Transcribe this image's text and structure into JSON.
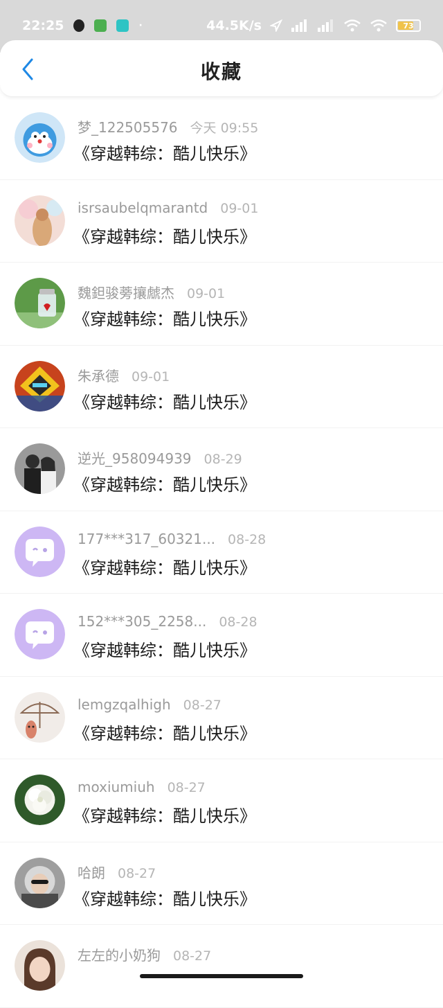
{
  "status_bar": {
    "time": "22:25",
    "speed": "44.5K/s",
    "battery": "73",
    "icons": [
      "qq-icon",
      "app-icon",
      "location-icon",
      "signal-icon",
      "wifi-icon"
    ]
  },
  "header": {
    "title": "收藏"
  },
  "items": [
    {
      "name": "梦_122505576",
      "time": "今天 09:55",
      "work": "《穿越韩综：酷儿快乐》",
      "avatar_color": "#5aa9e6"
    },
    {
      "name": "isrsaubelqmarantd",
      "time": "09-01",
      "work": "《穿越韩综：酷儿快乐》",
      "avatar_color": "#e8b8a8"
    },
    {
      "name": "魏鉭骏蒡攘虤杰",
      "time": "09-01",
      "work": "《穿越韩综：酷儿快乐》",
      "avatar_color": "#4e8a3c"
    },
    {
      "name": "朱承德",
      "time": "09-01",
      "work": "《穿越韩综：酷儿快乐》",
      "avatar_color": "#c7431d"
    },
    {
      "name": "逆光_958094939",
      "time": "08-29",
      "work": "《穿越韩综：酷儿快乐》",
      "avatar_color": "#3a3a3a"
    },
    {
      "name": "177***317_60321...",
      "time": "08-28",
      "work": "《穿越韩综：酷儿快乐》",
      "avatar_color": "#cbb6f2"
    },
    {
      "name": "152***305_2258...",
      "time": "08-28",
      "work": "《穿越韩综：酷儿快乐》",
      "avatar_color": "#cbb6f2"
    },
    {
      "name": "lemgzqalhigh",
      "time": "08-27",
      "work": "《穿越韩综：酷儿快乐》",
      "avatar_color": "#ede6e0"
    },
    {
      "name": "moxiumiuh",
      "time": "08-27",
      "work": "《穿越韩综：酷儿快乐》",
      "avatar_color": "#2f5a2a"
    },
    {
      "name": "哈朗",
      "time": "08-27",
      "work": "《穿越韩综：酷儿快乐》",
      "avatar_color": "#8d8d8d"
    },
    {
      "name": "左左的小奶狗",
      "time": "08-27",
      "work": "",
      "avatar_color": "#b07a5e"
    }
  ]
}
